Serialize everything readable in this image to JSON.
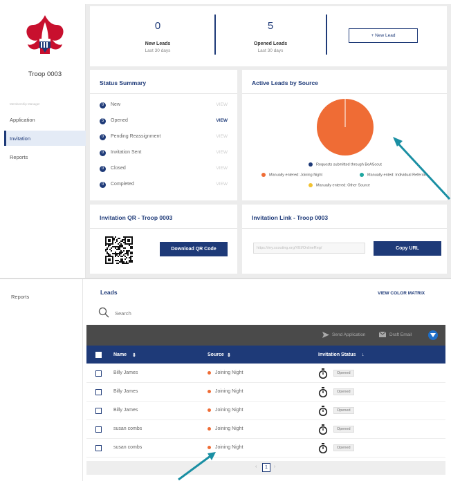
{
  "top": {
    "troop_name": "Troop 0003",
    "sidebar": {
      "group_label": "Membership Manager",
      "items": [
        "Application",
        "Invitation",
        "Reports"
      ],
      "active_index": 1
    },
    "stats": {
      "new_leads": {
        "value": "0",
        "label": "New Leads",
        "sub": "Last 30 days"
      },
      "opened_leads": {
        "value": "5",
        "label": "Opened Leads",
        "sub": "Last 30 days"
      },
      "new_lead_button": "+ New Lead"
    },
    "status_summary": {
      "title": "Status Summary",
      "rows": [
        {
          "count": "0",
          "label": "New",
          "action": "VIEW",
          "active": false
        },
        {
          "count": "5",
          "label": "Opened",
          "action": "VIEW",
          "active": true
        },
        {
          "count": "0",
          "label": "Pending Reassignment",
          "action": "VIEW",
          "active": false
        },
        {
          "count": "0",
          "label": "Invitation Sent",
          "action": "VIEW",
          "active": false
        },
        {
          "count": "0",
          "label": "Closed",
          "action": "VIEW",
          "active": false
        },
        {
          "count": "0",
          "label": "Completed",
          "action": "VIEW",
          "active": false
        }
      ]
    },
    "active_leads": {
      "title": "Active Leads by Source",
      "legend": [
        {
          "label": "Requests submitted through BeAScout",
          "color": "#1e3a78"
        },
        {
          "label": "Manually entered: Joining Night",
          "color": "#ef6c35"
        },
        {
          "label": "Manually ented: Individual Referral",
          "color": "#1fa7a0"
        },
        {
          "label": "Manually entered: Other Source",
          "color": "#f2c230"
        }
      ]
    },
    "qr": {
      "title": "Invitation QR - Troop 0003",
      "button": "Download QR Code"
    },
    "link": {
      "title": "Invitation Link - Troop 0003",
      "url": "https://my.scouting.org/VEI/OnlineReg/",
      "button": "Copy URL"
    }
  },
  "bottom": {
    "sidebar_item": "Reports",
    "leads_title": "Leads",
    "color_matrix": "VIEW COLOR MATRIX",
    "search_placeholder": "Search",
    "toolbar": {
      "send": "Send Application",
      "draft": "Draft Email"
    },
    "columns": [
      "Name",
      "Source",
      "Invitation Status"
    ],
    "rows": [
      {
        "name": "Billy James",
        "source": "Joining Night",
        "status": "Opened"
      },
      {
        "name": "Billy James",
        "source": "Joining Night",
        "status": "Opened"
      },
      {
        "name": "Billy James",
        "source": "Joining Night",
        "status": "Opened"
      },
      {
        "name": "susan combs",
        "source": "Joining Night",
        "status": "Opened"
      },
      {
        "name": "susan combs",
        "source": "Joining Night",
        "status": "Opened"
      }
    ],
    "page": "1"
  },
  "chart_data": {
    "type": "pie",
    "categories": [
      "Requests submitted through BeAScout",
      "Manually entered: Joining Night",
      "Manually ented: Individual Referral",
      "Manually entered: Other Source"
    ],
    "values": [
      0,
      5,
      0,
      0
    ],
    "colors": [
      "#1e3a78",
      "#ef6c35",
      "#1fa7a0",
      "#f2c230"
    ],
    "legend": "bottom"
  }
}
